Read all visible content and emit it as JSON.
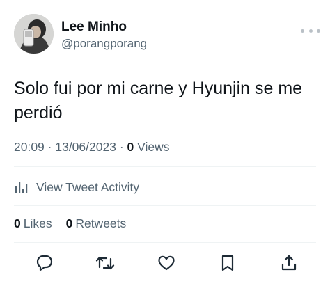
{
  "author": {
    "name": "Lee Minho",
    "handle": "@porangporang"
  },
  "tweet": {
    "text": "Solo fui por mi carne y Hyunjin se me perdió"
  },
  "meta": {
    "time": "20:09",
    "separator1": " · ",
    "date": "13/06/2023",
    "separator2": " · ",
    "views_count": "0",
    "views_label": " Views"
  },
  "activity": {
    "label": "View Tweet Activity"
  },
  "stats": {
    "likes_count": "0",
    "likes_label": "Likes",
    "retweets_count": "0",
    "retweets_label": "Retweets"
  },
  "icons": {
    "more": "more-dots-icon",
    "activity": "bar-chart-icon",
    "reply": "reply-icon",
    "retweet": "retweet-icon",
    "like": "heart-icon",
    "bookmark": "bookmark-icon",
    "share": "share-icon"
  },
  "colors": {
    "text": "#0f1419",
    "secondary": "#536471",
    "icon": "#1d2a35",
    "divider": "#eff3f4"
  }
}
